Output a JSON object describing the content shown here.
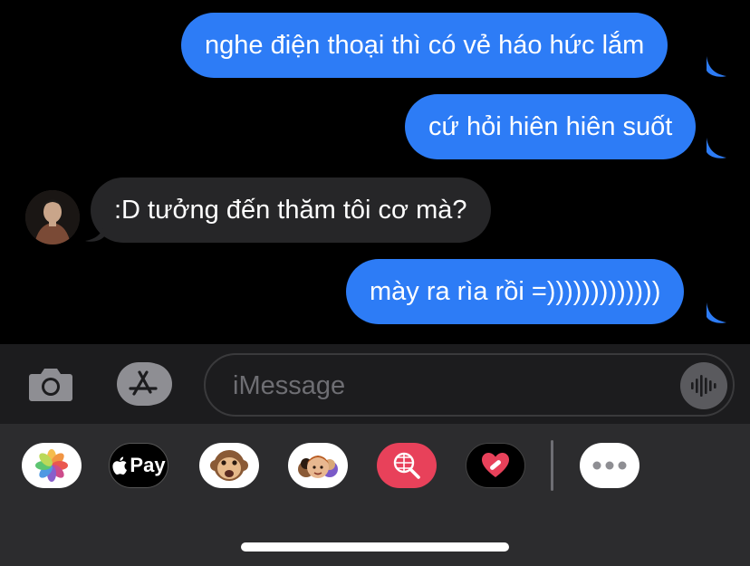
{
  "messages": [
    {
      "direction": "outgoing",
      "text": "nghe điện thoại thì có vẻ háo hức lắm"
    },
    {
      "direction": "outgoing",
      "text": "cứ hỏi hiên hiên suốt"
    },
    {
      "direction": "incoming",
      "text": ":D tưởng đến thăm tôi cơ mà?"
    },
    {
      "direction": "outgoing",
      "text": "mày ra rìa rồi =)))))))))))))"
    }
  ],
  "composer": {
    "placeholder": "iMessage",
    "camera_icon": "camera-icon",
    "apps_icon": "app-store-icon",
    "audio_icon": "audio-waveform-icon"
  },
  "app_tray": {
    "apps": [
      {
        "name": "photos",
        "icon": "photos-icon"
      },
      {
        "name": "apple-pay",
        "label": "Pay",
        "icon": "apple-logo-icon"
      },
      {
        "name": "animoji",
        "icon": "monkey-icon"
      },
      {
        "name": "memoji",
        "icon": "memoji-stickers-icon"
      },
      {
        "name": "images-search",
        "icon": "globe-search-icon"
      },
      {
        "name": "digital-touch",
        "icon": "heart-icon"
      },
      {
        "name": "more",
        "icon": "more-icon"
      }
    ]
  },
  "colors": {
    "outgoing_bubble": "#2d7cf6",
    "incoming_bubble": "#262628",
    "background": "#000000",
    "tray": "#2c2c2e"
  }
}
